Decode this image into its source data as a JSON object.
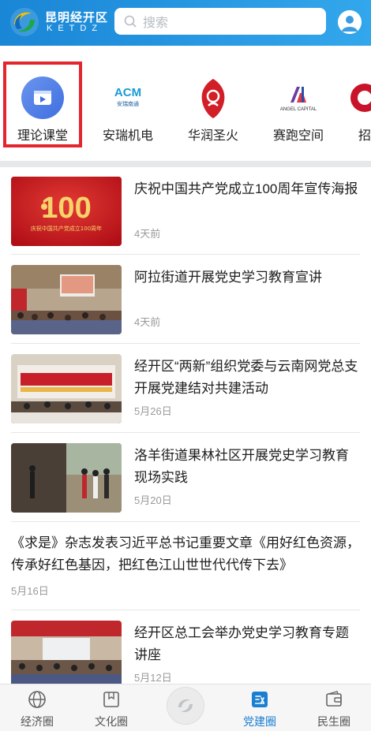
{
  "header": {
    "logo_cn": "昆明经开区",
    "logo_en": "KETDZ",
    "search_placeholder": "搜索"
  },
  "channels": [
    {
      "label": "理论课堂",
      "icon": "video-play-icon"
    },
    {
      "label": "安瑞机电",
      "icon": "acm-logo"
    },
    {
      "label": "华润圣火",
      "icon": "huarun-logo"
    },
    {
      "label": "赛跑空间",
      "icon": "angel-capital-logo"
    },
    {
      "label": "招",
      "icon": "partial-logo"
    }
  ],
  "feed": [
    {
      "title": "庆祝中国共产党成立100周年宣传海报",
      "date": "4天前"
    },
    {
      "title": "阿拉街道开展党史学习教育宣讲",
      "date": "4天前"
    },
    {
      "title": "经开区“两新”组织党委与云南网党总支开展党建结对共建活动",
      "date": "5月26日"
    },
    {
      "title": "洛羊街道果林社区开展党史学习教育现场实践",
      "date": "5月20日"
    },
    {
      "title": "《求是》杂志发表习近平总书记重要文章《用好红色资源，传承好红色基因，把红色江山世世代代传下去》",
      "date": "5月16日"
    },
    {
      "title": "经开区总工会举办党史学习教育专题讲座",
      "date": "5月12日"
    }
  ],
  "thumb_texts": {
    "poster_100": "100",
    "poster_caption": "庆祝中国共产党成立100周年",
    "acm_text": "ACM",
    "acm_sub": "安瑞南通",
    "angel_text": "ANGEL CAPITAL"
  },
  "bottom_nav": [
    {
      "label": "经济圈",
      "icon": "globe-icon",
      "active": false
    },
    {
      "label": "文化圈",
      "icon": "book-icon",
      "active": false
    },
    {
      "label": "",
      "icon": "logo-center-icon",
      "active": false
    },
    {
      "label": "党建圈",
      "icon": "party-icon",
      "active": true
    },
    {
      "label": "民生圈",
      "icon": "wallet-icon",
      "active": false
    }
  ],
  "colors": {
    "header_start": "#1a86d6",
    "header_end": "#33a7ec",
    "highlight": "#e3262d",
    "active_nav": "#1b7fd1"
  }
}
